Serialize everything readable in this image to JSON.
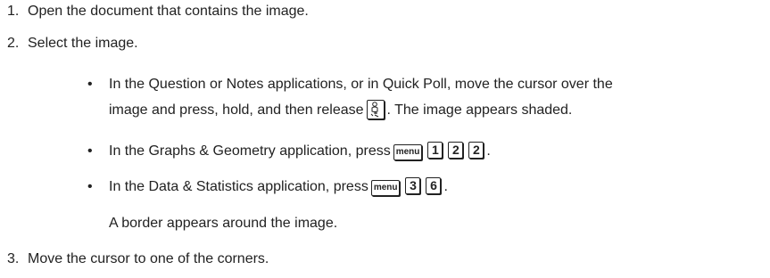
{
  "steps": [
    {
      "number": "1.",
      "text": "Open the document that contains the image."
    },
    {
      "number": "2.",
      "text": "Select the image."
    },
    {
      "number": "3.",
      "text": "Move the cursor to one of the corners."
    }
  ],
  "bullets": [
    {
      "symbol": "•",
      "line1": "In the Question or Notes applications, or in Quick Poll, move the cursor over the",
      "line2_a": "image and press, hold, and then release",
      "line2_b": ". The image appears shaded.",
      "key_icon": "hand-grab-icon"
    },
    {
      "symbol": "•",
      "text": "In the Graphs & Geometry application, press",
      "keys": [
        "menu",
        "1",
        "2",
        "2"
      ],
      "end": "."
    },
    {
      "symbol": "•",
      "text": "In the Data & Statistics application, press",
      "keys": [
        "menu",
        "3",
        "6"
      ],
      "end": "."
    }
  ],
  "note": "A border appears around the image."
}
